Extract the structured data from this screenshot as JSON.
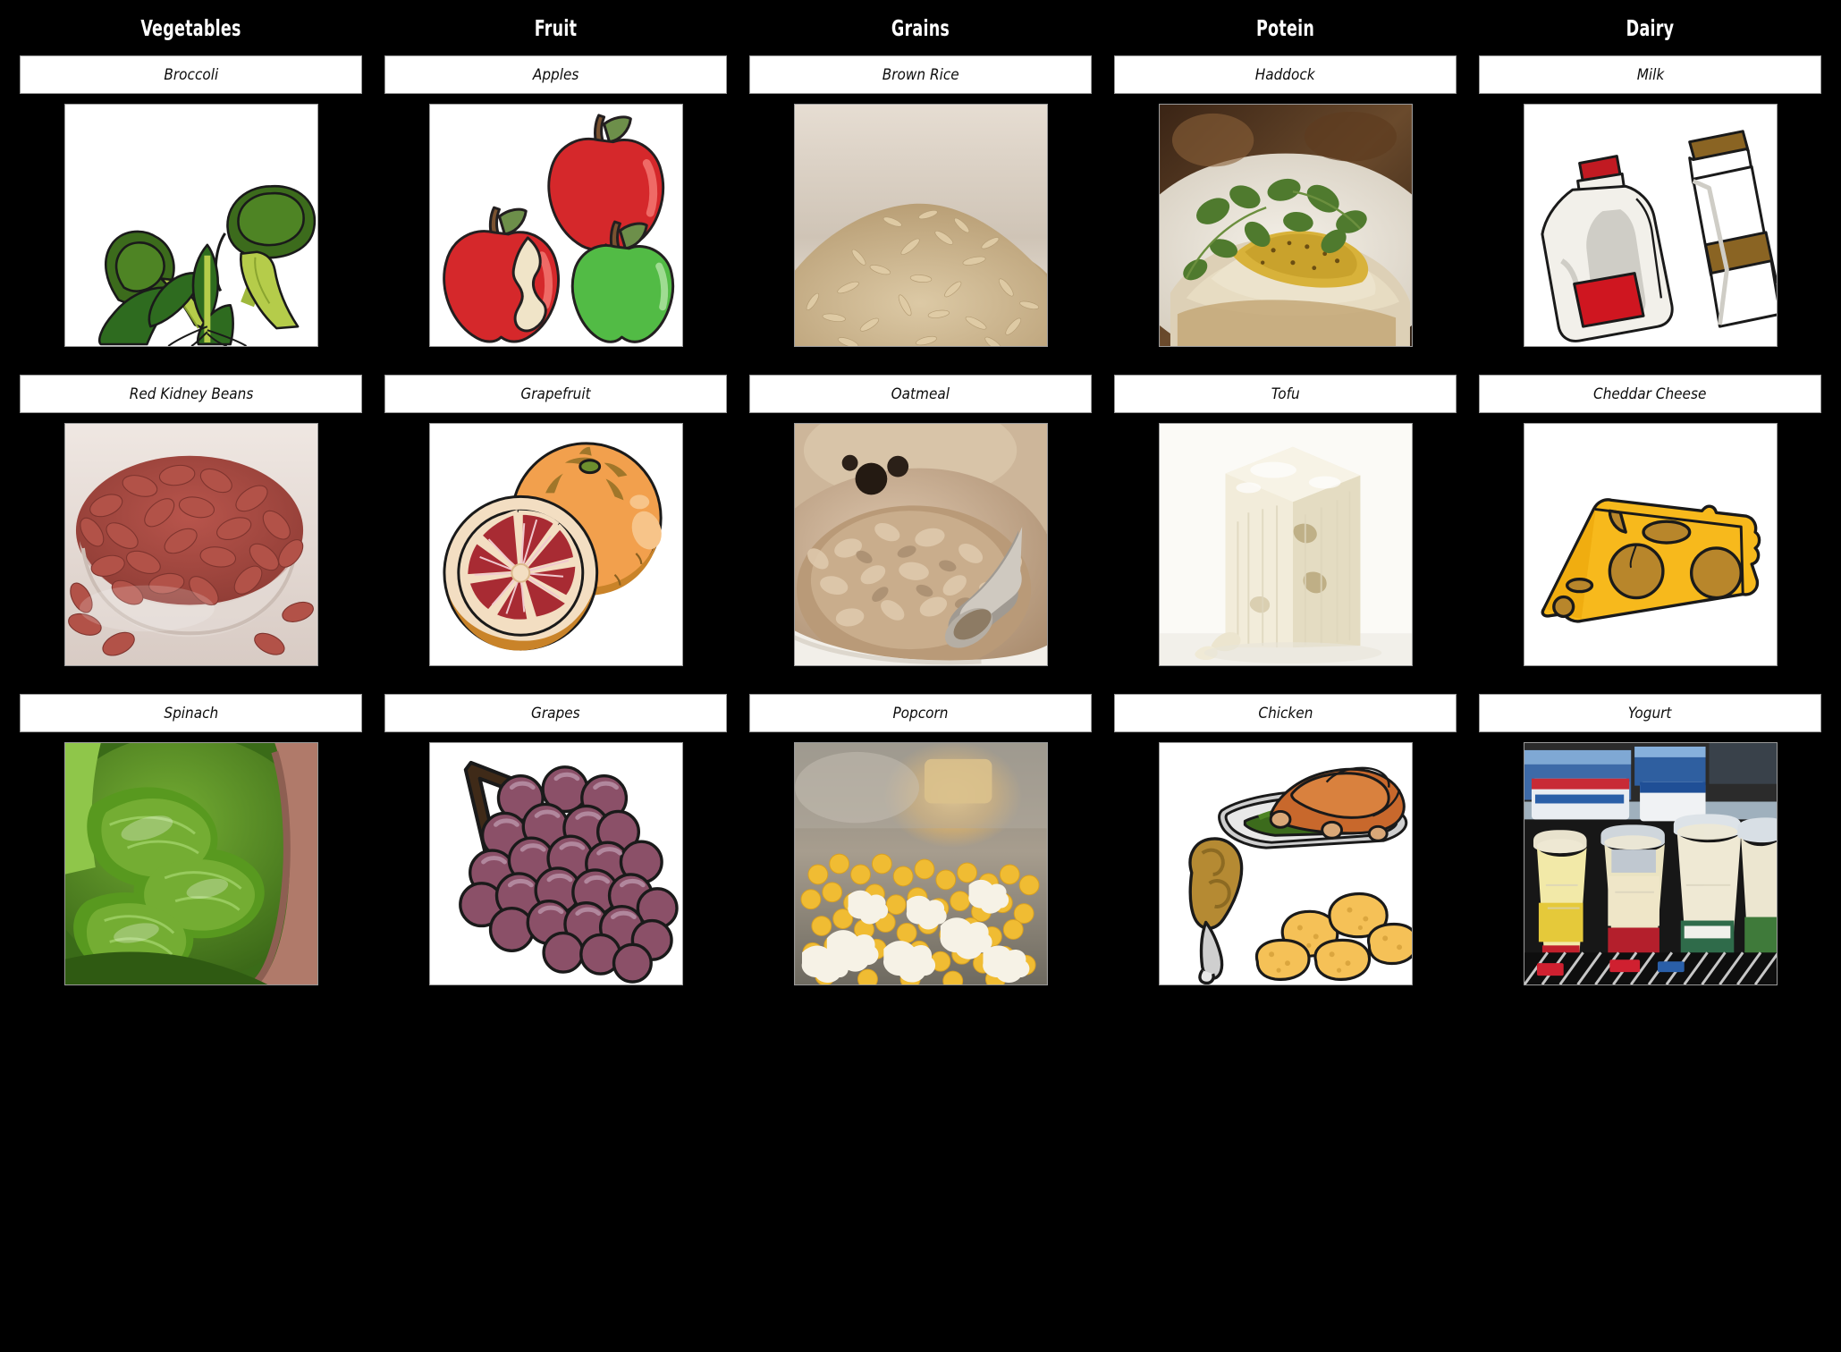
{
  "board": {
    "background": "#000000",
    "panel_bg": "#ffffff",
    "panel_border": "#9a9a9a",
    "header_color": "#ffffff",
    "columns": [
      "Vegetables",
      "Fruit",
      "Grains",
      "Potein",
      "Dairy"
    ],
    "rows": [
      {
        "cells": [
          {
            "caption": "Broccoli",
            "art": "broccoli",
            "kind": "clipart"
          },
          {
            "caption": "Apples",
            "art": "apples",
            "kind": "clipart"
          },
          {
            "caption": "Brown Rice",
            "art": "brown-rice",
            "kind": "photo"
          },
          {
            "caption": "Haddock",
            "art": "haddock",
            "kind": "photo"
          },
          {
            "caption": "Milk",
            "art": "milk",
            "kind": "clipart"
          }
        ]
      },
      {
        "cells": [
          {
            "caption": "Red Kidney Beans",
            "art": "kidney-beans",
            "kind": "photo"
          },
          {
            "caption": "Grapefruit",
            "art": "grapefruit",
            "kind": "clipart"
          },
          {
            "caption": "Oatmeal",
            "art": "oatmeal",
            "kind": "photo"
          },
          {
            "caption": "Tofu",
            "art": "tofu",
            "kind": "photo"
          },
          {
            "caption": "Cheddar Cheese",
            "art": "cheese",
            "kind": "clipart"
          }
        ]
      },
      {
        "cells": [
          {
            "caption": "Spinach",
            "art": "spinach",
            "kind": "photo"
          },
          {
            "caption": "Grapes",
            "art": "grapes",
            "kind": "clipart"
          },
          {
            "caption": "Popcorn",
            "art": "popcorn",
            "kind": "photo"
          },
          {
            "caption": "Chicken",
            "art": "chicken",
            "kind": "clipart"
          },
          {
            "caption": "Yogurt",
            "art": "yogurt",
            "kind": "photo"
          }
        ]
      }
    ]
  },
  "palette": {
    "broccoli_head": "#2f5418",
    "broccoli_head_light": "#4a7a22",
    "broccoli_stalk": "#b5cc4a",
    "broccoli_leaf": "#2e6b1f",
    "apple_red": "#d5282b",
    "apple_green": "#52bb45",
    "apple_core": "#f0e4c8",
    "stem_brown": "#7a5230",
    "leaf_green": "#6d8f4a",
    "rice_tan": "#d8c49c",
    "rice_bg": "#cfc3b4",
    "fish_plate": "#efeae2",
    "fish_sauce": "#c9a22c",
    "fish_herb": "#4f7a2e",
    "fish_bg": "#2a1a10",
    "milk_jug": "#f2f0ea",
    "milk_jug_shade": "#cfcdc6",
    "milk_cap": "#c11a22",
    "milk_label": "#cf1620",
    "carton_brown": "#8a6423",
    "bean_red": "#b25248",
    "bean_dark": "#8d3a34",
    "bowl_glass": "#e8e2de",
    "orange_peel": "#f2a04d",
    "orange_shade": "#c98329",
    "grapefruit_flesh": "#a82b33",
    "grapefruit_pith": "#f3dec2",
    "oat_light": "#cfb69b",
    "oat_dark": "#9c8066",
    "oat_bowl": "#f2efe9",
    "tofu_cream": "#f0ebd8",
    "tofu_shade": "#ded6bd",
    "cheese_yellow": "#f7b91c",
    "cheese_hole": "#b8862b",
    "spinach_green": "#4f8a1f",
    "spinach_dark": "#2f5a12",
    "spinach_pot": "#b8857a",
    "grape_purple": "#8b5068",
    "grape_light": "#a87188",
    "grape_stem": "#3f2a18",
    "popcorn_white": "#f6f2e6",
    "popcorn_kernel": "#f0bc33",
    "popcorn_bg": "#9e9284",
    "turkey_orange": "#c8682c",
    "drumstick_tan": "#b58a33",
    "nugget_yellow": "#f5c157",
    "platter_silver": "#cfcfcf",
    "yogurt_cream": "#efe6c8",
    "yogurt_blue": "#2a5fa8",
    "yogurt_red": "#c1202c",
    "yogurt_green": "#3f7a3a",
    "yogurt_bg": "#161616"
  }
}
